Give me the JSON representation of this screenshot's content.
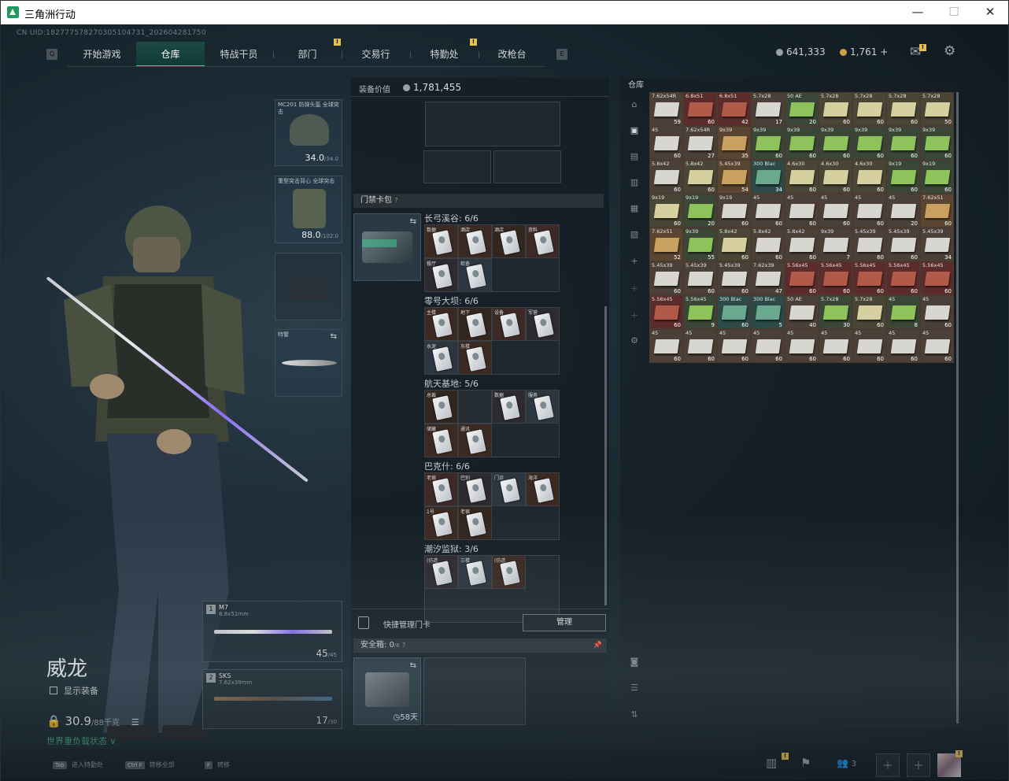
{
  "window": {
    "title": "三角洲行动",
    "min": "—",
    "max": "☐",
    "close": "✕"
  },
  "uid": "CN UID:18277757827030510473​1_202604281750",
  "nav": {
    "tabs": [
      "开始游戏",
      "仓库",
      "特战干员",
      "部门",
      "交易行",
      "特勤处",
      "改枪台"
    ],
    "active": 1,
    "badge": "!"
  },
  "currency": {
    "silver": "641,333",
    "gold": "1,761",
    "plus": "+"
  },
  "icons": {
    "mail": "mail-icon",
    "settings": "gear-icon"
  },
  "operator": {
    "name": "威龙",
    "show_gear": "显示装备",
    "weight": "30.9",
    "weight_max": "/88千克",
    "status": "世界重负载状态",
    "status_arrow": "∨"
  },
  "gear": {
    "helmet": {
      "label": "MC201 防弹头盔 全球突击",
      "val": "34.0",
      "max": "/34.0"
    },
    "armor": {
      "label": "重型突击背心 全球突击",
      "val": "88.0",
      "max": "/102.0"
    },
    "melee": {
      "label": "特警"
    }
  },
  "weapons": [
    {
      "slot": "1",
      "name": "M7",
      "cal": "6.8x51mm",
      "ammo": "45",
      "max": "/45"
    },
    {
      "slot": "2",
      "name": "SKS",
      "cal": "7.62x39mm",
      "ammo": "17",
      "max": "/30"
    }
  ],
  "loadout": {
    "value_label": "装备价值",
    "value": "1,781,455",
    "keycard_header": "门禁卡包",
    "help": "?"
  },
  "maps": [
    {
      "name": "长弓溪谷: 6/6",
      "cards": [
        "数据",
        "酒店",
        "酒店",
        "资料",
        "餐厅",
        "检查"
      ]
    },
    {
      "name": "零号大坝: 6/6",
      "cards": [
        "主楼",
        "地下",
        "设备",
        "军营",
        "水泥",
        "东楼"
      ]
    },
    {
      "name": "航天基地: 5/6",
      "cards": [
        "总裁",
        "",
        "数据",
        "服务",
        "储藏",
        "通讯"
      ]
    },
    {
      "name": "巴克什: 6/6",
      "cards": [
        "老宿",
        "巴别",
        "门诊",
        "海洋",
        "1号",
        "老宿"
      ]
    },
    {
      "name": "潮汐监狱: 3/6",
      "cards": [
        "(仿造",
        "三楼",
        "(仿造"
      ]
    }
  ],
  "quick": {
    "label": "快捷管理门卡",
    "button": "管理"
  },
  "safe": {
    "label": "安全箱:",
    "count": "0",
    "max": "/6",
    "help": "?",
    "days": "58天"
  },
  "warehouse": {
    "title": "仓库",
    "items": [
      [
        "7.62x54R",
        "59",
        "w"
      ],
      [
        "6.8x51",
        "60",
        "r"
      ],
      [
        "6.8x51",
        "42",
        "r"
      ],
      [
        "5.7x28",
        "17",
        "w"
      ],
      [
        "50 AE",
        "20",
        "g"
      ],
      [
        "5.7x28",
        "60",
        "y"
      ],
      [
        "5.7x28",
        "60",
        "y"
      ],
      [
        "5.7x28",
        "60",
        "y"
      ],
      [
        "5.7x28",
        "50",
        "y"
      ],
      [
        "45",
        "60",
        "w"
      ],
      [
        "7.62x54R",
        "27",
        "w"
      ],
      [
        "9x39",
        "35",
        "o"
      ],
      [
        "9x39",
        "60",
        "g"
      ],
      [
        "9x39",
        "60",
        "g"
      ],
      [
        "9x39",
        "60",
        "g"
      ],
      [
        "9x39",
        "60",
        "g"
      ],
      [
        "9x39",
        "60",
        "g"
      ],
      [
        "9x39",
        "60",
        "g"
      ],
      [
        "5.8x42",
        "60",
        "w"
      ],
      [
        "5.8x42",
        "60",
        "y"
      ],
      [
        "5.45x39",
        "54",
        "o"
      ],
      [
        "300 Blac",
        "34",
        "c"
      ],
      [
        "4.6x30",
        "60",
        "y"
      ],
      [
        "4.6x30",
        "60",
        "y"
      ],
      [
        "4.6x30",
        "60",
        "y"
      ],
      [
        "9x19",
        "60",
        "g"
      ],
      [
        "9x19",
        "60",
        "g"
      ],
      [
        "9x19",
        "60",
        "y"
      ],
      [
        "9x19",
        "20",
        "g"
      ],
      [
        "9x19",
        "60",
        "w"
      ],
      [
        "45",
        "60",
        "w"
      ],
      [
        "45",
        "60",
        "w"
      ],
      [
        "45",
        "60",
        "w"
      ],
      [
        "45",
        "60",
        "w"
      ],
      [
        "45",
        "20",
        "w"
      ],
      [
        "7.62x51",
        "60",
        "o"
      ],
      [
        "7.62x51",
        "52",
        "o"
      ],
      [
        "9x39",
        "55",
        "g"
      ],
      [
        "5.8x42",
        "60",
        "y"
      ],
      [
        "5.8x42",
        "60",
        "w"
      ],
      [
        "5.8x42",
        "60",
        "w"
      ],
      [
        "9x39",
        "7",
        "w"
      ],
      [
        "5.45x39",
        "60",
        "w"
      ],
      [
        "5.45x39",
        "60",
        "w"
      ],
      [
        "5.45x39",
        "34",
        "w"
      ],
      [
        "5.45x39",
        "60",
        "w"
      ],
      [
        "5.45x39",
        "60",
        "w"
      ],
      [
        "5.45x39",
        "60",
        "w"
      ],
      [
        "7.62x39",
        "47",
        "w"
      ],
      [
        "5.56x45",
        "60",
        "r"
      ],
      [
        "5.56x45",
        "60",
        "r"
      ],
      [
        "5.56x45",
        "60",
        "r"
      ],
      [
        "5.56x45",
        "60",
        "r"
      ],
      [
        "5.56x45",
        "60",
        "r"
      ],
      [
        "5.56x45",
        "60",
        "r"
      ],
      [
        "5.56x45",
        "9",
        "g"
      ],
      [
        "300 Blac",
        "60",
        "c"
      ],
      [
        "300 Blac",
        "5",
        "c"
      ],
      [
        "50 AE",
        "40",
        "w"
      ],
      [
        "5.7x28",
        "30",
        "g"
      ],
      [
        "5.7x28",
        "60",
        "y"
      ],
      [
        "45",
        "8",
        "g"
      ],
      [
        "45",
        "60",
        "w"
      ],
      [
        "45",
        "60",
        "w"
      ],
      [
        "45",
        "60",
        "w"
      ],
      [
        "45",
        "60",
        "w"
      ],
      [
        "45",
        "60",
        "w"
      ],
      [
        "45",
        "60",
        "w"
      ],
      [
        "45",
        "60",
        "w"
      ],
      [
        "45",
        "60",
        "w"
      ],
      [
        "45",
        "60",
        "w"
      ],
      [
        "45",
        "60",
        "w"
      ]
    ]
  },
  "bottom": {
    "hints": [
      {
        "key": "Tab",
        "label": "进入特勤处"
      },
      {
        "key": "Ctrl F",
        "label": "转移全部"
      },
      {
        "key": "F",
        "label": "转移"
      }
    ],
    "friends": "3",
    "badge": "!"
  },
  "colors": {
    "accent": "#3fd09c",
    "active_tab": "#1d4a44",
    "badge": "#e5c04a"
  }
}
